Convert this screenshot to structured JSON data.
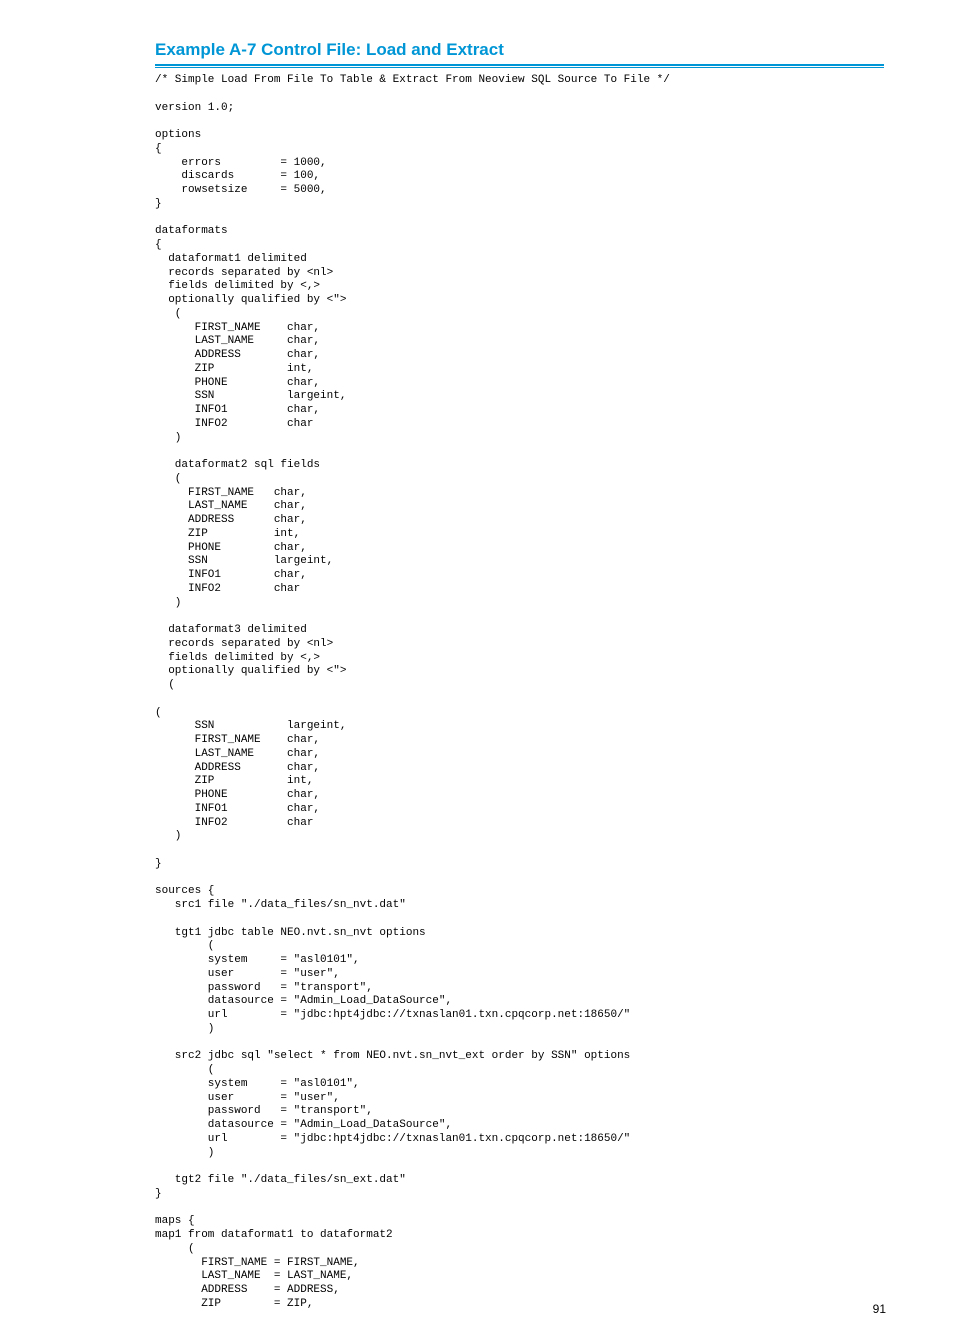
{
  "heading": "Example A-7 Control File: Load and Extract",
  "page_number": "91",
  "code": "/* Simple Load From File To Table & Extract From Neoview SQL Source To File */\n\nversion 1.0;\n\noptions\n{\n    errors         = 1000,\n    discards       = 100,\n    rowsetsize     = 5000,\n}\n\ndataformats\n{\n  dataformat1 delimited\n  records separated by <nl>\n  fields delimited by <,>\n  optionally qualified by <\">\n   (\n      FIRST_NAME    char,\n      LAST_NAME     char,\n      ADDRESS       char,\n      ZIP           int,\n      PHONE         char,\n      SSN           largeint,\n      INFO1         char,\n      INFO2         char\n   )\n\n   dataformat2 sql fields\n   (\n     FIRST_NAME   char,\n     LAST_NAME    char,\n     ADDRESS      char,\n     ZIP          int,\n     PHONE        char,\n     SSN          largeint,\n     INFO1        char,\n     INFO2        char\n   )\n\n  dataformat3 delimited\n  records separated by <nl>\n  fields delimited by <,>\n  optionally qualified by <\">\n  (\n\n(\n      SSN           largeint,\n      FIRST_NAME    char,\n      LAST_NAME     char,\n      ADDRESS       char,\n      ZIP           int,\n      PHONE         char,\n      INFO1         char,\n      INFO2         char\n   )\n\n}\n\nsources {\n   src1 file \"./data_files/sn_nvt.dat\"\n\n   tgt1 jdbc table NEO.nvt.sn_nvt options\n        (\n        system     = \"asl0101\",\n        user       = \"user\",\n        password   = \"transport\",\n        datasource = \"Admin_Load_DataSource\",\n        url        = \"jdbc:hpt4jdbc://txnaslan01.txn.cpqcorp.net:18650/\"\n        )\n\n   src2 jdbc sql \"select * from NEO.nvt.sn_nvt_ext order by SSN\" options\n        (\n        system     = \"asl0101\",\n        user       = \"user\",\n        password   = \"transport\",\n        datasource = \"Admin_Load_DataSource\",\n        url        = \"jdbc:hpt4jdbc://txnaslan01.txn.cpqcorp.net:18650/\"\n        )\n\n   tgt2 file \"./data_files/sn_ext.dat\"\n}\n\nmaps {\nmap1 from dataformat1 to dataformat2\n     (\n       FIRST_NAME = FIRST_NAME,\n       LAST_NAME  = LAST_NAME,\n       ADDRESS    = ADDRESS,\n       ZIP        = ZIP,"
}
